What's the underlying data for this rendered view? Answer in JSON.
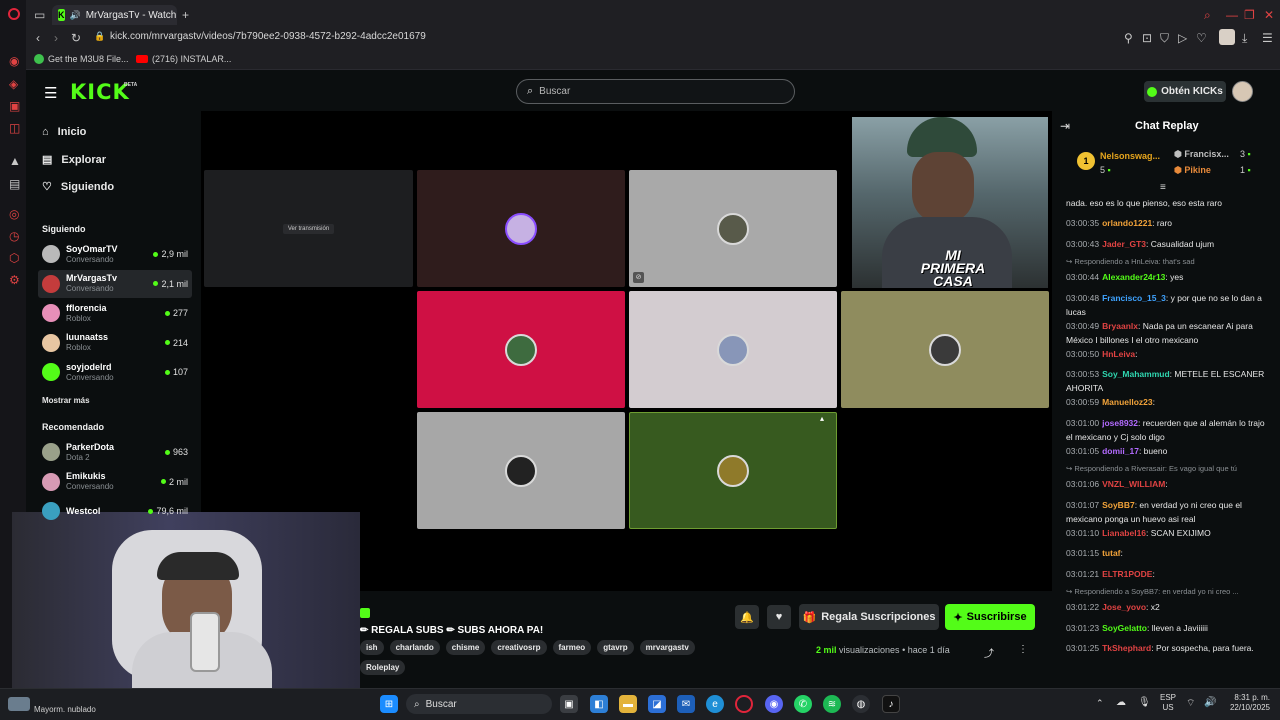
{
  "browser": {
    "tab_title": "MrVargasTv - Watch th",
    "url": "kick.com/mrvargastv/videos/7b790ee2-0938-4572-b292-4adcc2e01679",
    "bookmarks": [
      "Get the M3U8 File...",
      "(2716) INSTALAR..."
    ]
  },
  "header": {
    "logo": "KICK",
    "logo_badge": "BETA",
    "search_placeholder": "Buscar",
    "kicks_button": "Obtén KICKs"
  },
  "sidebar": {
    "nav": [
      {
        "label": "Inicio",
        "icon": "home-icon"
      },
      {
        "label": "Explorar",
        "icon": "browse-icon"
      },
      {
        "label": "Siguiendo",
        "icon": "heart-icon"
      }
    ],
    "following_title": "Siguiendo",
    "following": [
      {
        "name": "SoyOmarTV",
        "status": "Conversando",
        "viewers": "2,9 mil",
        "color": "#b9b9b9"
      },
      {
        "name": "MrVargasTv",
        "status": "Conversando",
        "viewers": "2,1 mil",
        "color": "#c43c3c"
      },
      {
        "name": "fflorencia",
        "status": "Roblox",
        "viewers": "277",
        "color": "#e78fb8"
      },
      {
        "name": "luunaatss",
        "status": "Roblox",
        "viewers": "214",
        "color": "#e8c6a2"
      },
      {
        "name": "soyjodelrd",
        "status": "Conversando",
        "viewers": "107",
        "color": "#53fc18"
      }
    ],
    "show_more": "Mostrar más",
    "recommended_title": "Recomendado",
    "recommended": [
      {
        "name": "ParkerDota",
        "status": "Dota 2",
        "viewers": "963",
        "color": "#9aa08a"
      },
      {
        "name": "Emikukis",
        "status": "Conversando",
        "viewers": "2 mil",
        "color": "#d79ab4"
      },
      {
        "name": "Westcol",
        "status": "",
        "viewers": "79,6 mil",
        "color": "#3a9fbf"
      }
    ]
  },
  "video": {
    "tile_label": "Ver transmisión",
    "overlay_text": "MI PRIMERA CASA"
  },
  "stream_info": {
    "title": "REGALA SUBS ✏ SUBS AHORA PA!",
    "tags": [
      "ish",
      "charlando",
      "chisme",
      "creativosrp",
      "farmeo",
      "gtavrp",
      "mrvargastv"
    ],
    "tag_extra": "Roleplay",
    "gift_button": "Regala Suscripciones",
    "subscribe_button": "Suscribirse",
    "views_count": "2 mil",
    "views_label": "visualizaciones",
    "time_ago": "hace 1 día"
  },
  "chat": {
    "title": "Chat Replay",
    "gifters": [
      {
        "name": "Nelsonswag...",
        "count": "5",
        "color": "#e6a51d"
      },
      {
        "name": "Francisx...",
        "count": "3",
        "color": "#bfbfbf"
      },
      {
        "name": "Pikine",
        "count": "1",
        "color": "#e88a3a"
      }
    ],
    "first_line": "nada. eso es lo que pienso, eso esta raro",
    "messages": [
      {
        "time": "03:00:35",
        "user": "orlando1221",
        "color": "#f2a33a",
        "text": ": raro"
      },
      {
        "time": "03:00:43",
        "user": "Jader_GT3",
        "color": "#e04343",
        "text": ": Casualidad ujum"
      },
      {
        "reply": "Respondiendo a HnLeiva: that's sad"
      },
      {
        "time": "03:00:44",
        "user": "Alexander24r13",
        "color": "#53fc18",
        "text": ": yes"
      },
      {
        "time": "03:00:48",
        "user": "Francisco_15_3",
        "color": "#3fa3ff",
        "text": ": y por que no se lo dan a lucas"
      },
      {
        "time": "03:00:49",
        "user": "Bryaanlx",
        "color": "#e04343",
        "text": ": Nada pa un escanear Ai para México I billones I el otro mexicano"
      },
      {
        "time": "03:00:50",
        "user": "HnLeiva",
        "color": "#e04343",
        "text": ":"
      },
      {
        "time": "03:00:53",
        "user": "Soy_Mahammud",
        "color": "#2fd6b0",
        "text": ": METELE EL ESCANER AHORITA"
      },
      {
        "time": "03:00:59",
        "user": "Manuelloz23",
        "color": "#f2a33a",
        "text": ":"
      },
      {
        "time": "03:01:00",
        "user": "jose8932",
        "color": "#b36bff",
        "text": ": recuerden que al alemán lo trajo el mexicano y Cj solo digo"
      },
      {
        "time": "03:01:05",
        "user": "domii_17",
        "color": "#b36bff",
        "text": ": bueno"
      },
      {
        "reply": "Respondiendo a Riverasair: Es vago igual que tú"
      },
      {
        "time": "03:01:06",
        "user": "VNZL_WILLIAM",
        "color": "#e04343",
        "text": ":"
      },
      {
        "time": "03:01:07",
        "user": "SoyBB7",
        "color": "#f2a33a",
        "text": ": en verdad yo ni creo que el mexicano ponga un huevo asi real"
      },
      {
        "time": "03:01:10",
        "user": "Lianabel16",
        "color": "#e04343",
        "text": ": SCAN EXIJIMO"
      },
      {
        "time": "03:01:15",
        "user": "tutaf",
        "color": "#f2a33a",
        "text": ":"
      },
      {
        "time": "03:01:21",
        "user": "ELTR1PODE",
        "color": "#e04343",
        "text": ":"
      },
      {
        "reply": "Respondiendo a SoyBB7: en verdad yo ni creo ..."
      },
      {
        "time": "03:01:22",
        "user": "Jose_yovo",
        "color": "#e04343",
        "text": ": x2"
      },
      {
        "time": "03:01:23",
        "user": "SoyGelatto",
        "color": "#53fc18",
        "text": ": lleven a Javiiiiii"
      },
      {
        "time": "03:01:25",
        "user": "TkShephard",
        "color": "#e04343",
        "text": ": Por sospecha, para fuera."
      }
    ]
  },
  "webcam": {
    "weather": "Mayorm. nublado"
  },
  "taskbar": {
    "search": "Buscar",
    "lang": "ESP",
    "region": "US",
    "time": "8:31 p. m.",
    "date": "22/10/2025"
  }
}
